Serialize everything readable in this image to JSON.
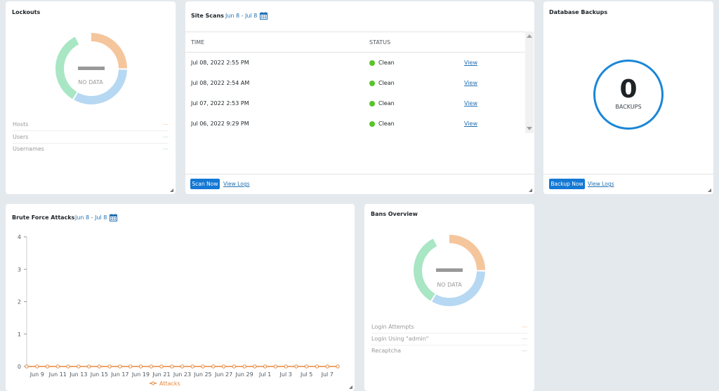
{
  "lockouts": {
    "title": "Lockouts",
    "no_data": "NO DATA",
    "legend": [
      {
        "label": "Hosts",
        "value": "—",
        "color": "#f5c59c"
      },
      {
        "label": "Users",
        "value": "—",
        "color": "#a8e3c0"
      },
      {
        "label": "Usernames",
        "value": "—",
        "color": "#a8e3c0"
      }
    ]
  },
  "site_scans": {
    "title": "Site Scans",
    "date_range": "Jun 8 - Jul 8",
    "col_time": "TIME",
    "col_status": "STATUS",
    "rows": [
      {
        "time": "Jul 08, 2022 2:55 PM",
        "status": "Clean",
        "link": "View"
      },
      {
        "time": "Jul 08, 2022 2:54 AM",
        "status": "Clean",
        "link": "View"
      },
      {
        "time": "Jul 07, 2022 2:53 PM",
        "status": "Clean",
        "link": "View"
      },
      {
        "time": "Jul 06, 2022 9:29 PM",
        "status": "Clean",
        "link": "View"
      }
    ],
    "scan_button": "Scan Now",
    "logs_link": "View Logs"
  },
  "backups": {
    "title": "Database Backups",
    "count": "0",
    "label": "BACKUPS",
    "button": "Backup Now",
    "logs_link": "View Logs"
  },
  "brute_force": {
    "title": "Brute Force Attacks",
    "date_range": "Jun 8 - Jul 8"
  },
  "bans": {
    "title": "Bans Overview",
    "no_data": "NO DATA",
    "legend": [
      {
        "label": "Login Attempts",
        "value": "—",
        "color": "#f5c59c"
      },
      {
        "label": "Login Using \"admin\"",
        "value": "—",
        "color": "#cccccc"
      },
      {
        "label": "Recaptcha",
        "value": "—",
        "color": "#cccccc"
      }
    ]
  },
  "chart_data": {
    "type": "line",
    "x": [
      "Jun 8",
      "Jun 9",
      "Jun 10",
      "Jun 11",
      "Jun 12",
      "Jun 13",
      "Jun 14",
      "Jun 15",
      "Jun 16",
      "Jun 17",
      "Jun 18",
      "Jun 19",
      "Jun 20",
      "Jun 21",
      "Jun 22",
      "Jun 23",
      "Jun 24",
      "Jun 25",
      "Jun 26",
      "Jun 27",
      "Jun 28",
      "Jun 29",
      "Jun 30",
      "Jul 1",
      "Jul 2",
      "Jul 3",
      "Jul 4",
      "Jul 5",
      "Jul 6",
      "Jul 7",
      "Jul 8"
    ],
    "tick_labels": [
      "Jun 9",
      "Jun 11",
      "Jun 13",
      "Jun 15",
      "Jun 17",
      "Jun 19",
      "Jun 21",
      "Jun 23",
      "Jun 25",
      "Jun 27",
      "Jun 29",
      "Jul 1",
      "Jul 3",
      "Jul 5",
      "Jul 7"
    ],
    "series": [
      {
        "name": "Attacks",
        "color": "#e8873a",
        "values": [
          0,
          0,
          0,
          0,
          0,
          0,
          0,
          0,
          0,
          0,
          0,
          0,
          0,
          0,
          0,
          0,
          0,
          0,
          0,
          0,
          0,
          0,
          0,
          0,
          0,
          0,
          0,
          0,
          0,
          0,
          0
        ]
      }
    ],
    "y_ticks": [
      "0",
      "1",
      "2",
      "3",
      "4"
    ],
    "ylim": [
      0,
      4
    ],
    "legend_position": "bottom"
  }
}
